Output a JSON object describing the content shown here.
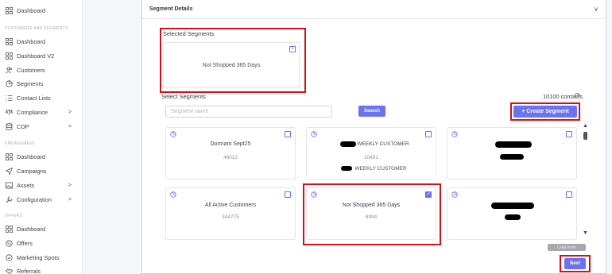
{
  "sidebar": {
    "top_item": {
      "label": "Dashboard",
      "icon": "grid-icon"
    },
    "section1": "CUSTOMERS AND SEGMENTS",
    "group1": [
      {
        "label": "Dashboard",
        "icon": "grid-icon"
      },
      {
        "label": "Dashboard V2",
        "icon": "grid-icon"
      },
      {
        "label": "Customers",
        "icon": "users-icon"
      },
      {
        "label": "Segments",
        "icon": "pie-icon"
      },
      {
        "label": "Contact Lists",
        "icon": "list-icon"
      },
      {
        "label": "Compliance",
        "icon": "scale-icon",
        "chevron": ">"
      },
      {
        "label": "CDP",
        "icon": "database-icon",
        "chevron": ">"
      }
    ],
    "section2": "ENGAGEMENT",
    "group2": [
      {
        "label": "Dashboard",
        "icon": "grid-icon"
      },
      {
        "label": "Campaigns",
        "icon": "send-icon"
      },
      {
        "label": "Assets",
        "icon": "image-icon",
        "chevron": ">"
      },
      {
        "label": "Configuration",
        "icon": "wrench-icon",
        "chevron": ">"
      }
    ],
    "section3": "OFFERS",
    "group3": [
      {
        "label": "Dashboard",
        "icon": "grid-icon"
      },
      {
        "label": "Offers",
        "icon": "tag-icon"
      },
      {
        "label": "Marketing Spots",
        "icon": "check-circle-icon"
      },
      {
        "label": "Referrals",
        "icon": "handshake-icon"
      }
    ]
  },
  "panel": {
    "title": "Segment Details",
    "chevron": "∨",
    "selected_label": "Selected Segments",
    "selected_chip": "Not Shopped 365 Days",
    "select_label": "Select Segments",
    "contacts": "10100 contacts",
    "search_placeholder": "Segment name",
    "search_button": "Search",
    "create_button": "+ Create Segment",
    "load_more": "Load more",
    "next_button": "Next"
  },
  "cards": [
    {
      "name": "Dormant Sept25",
      "count": "46012",
      "checked": false
    },
    {
      "name": "WEEKLY CUSTOMER",
      "count": "10491",
      "subtitle": "WEEKLY CUSTOMER",
      "checked": false
    },
    {
      "name": "",
      "count": "",
      "checked": false
    },
    {
      "name": "All Active Customers",
      "count": "344775",
      "checked": false
    },
    {
      "name": "Not Shopped 365 Days",
      "count": "8994",
      "checked": true
    },
    {
      "name": "",
      "count": "",
      "checked": false
    }
  ],
  "colors": {
    "accent": "#6c72f0",
    "highlight": "#d0111b"
  }
}
